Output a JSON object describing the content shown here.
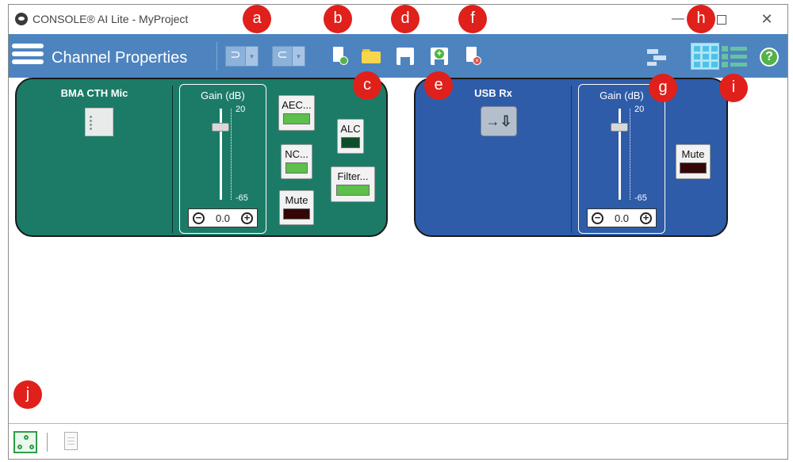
{
  "window": {
    "title": "CONSOLE® AI Lite - MyProject",
    "minimize": "—",
    "close": "✕"
  },
  "toolbar": {
    "title": "Channel Properties",
    "undo_glyph": "⊃",
    "redo_glyph": "⊂",
    "dropdown_glyph": "▾",
    "delete_badge": "×",
    "saveas_badge": "+",
    "help": "?"
  },
  "channels": [
    {
      "name": "BMA CTH Mic",
      "color": "#1c7b67",
      "gain": {
        "label": "Gain  (dB)",
        "max": "20",
        "min": "-65",
        "value": "0.0"
      },
      "buttons": {
        "aec": "AEC...",
        "nc": "NC...",
        "mute": "Mute",
        "alc": "ALC",
        "filter": "Filter..."
      }
    },
    {
      "name": "USB Rx",
      "color": "#2e5ca8",
      "usb_glyph": "→⇩",
      "gain": {
        "label": "Gain  (dB)",
        "max": "20",
        "min": "-65",
        "value": "0.0"
      },
      "buttons": {
        "mute": "Mute"
      }
    }
  ],
  "stepper": {
    "minus": "−",
    "plus": "+"
  },
  "callouts": [
    "a",
    "b",
    "c",
    "d",
    "e",
    "f",
    "g",
    "h",
    "i",
    "j"
  ],
  "colors": {
    "toolbar": "#4d84bf",
    "callout": "#e0201b",
    "led_on": "#5cc04a"
  }
}
